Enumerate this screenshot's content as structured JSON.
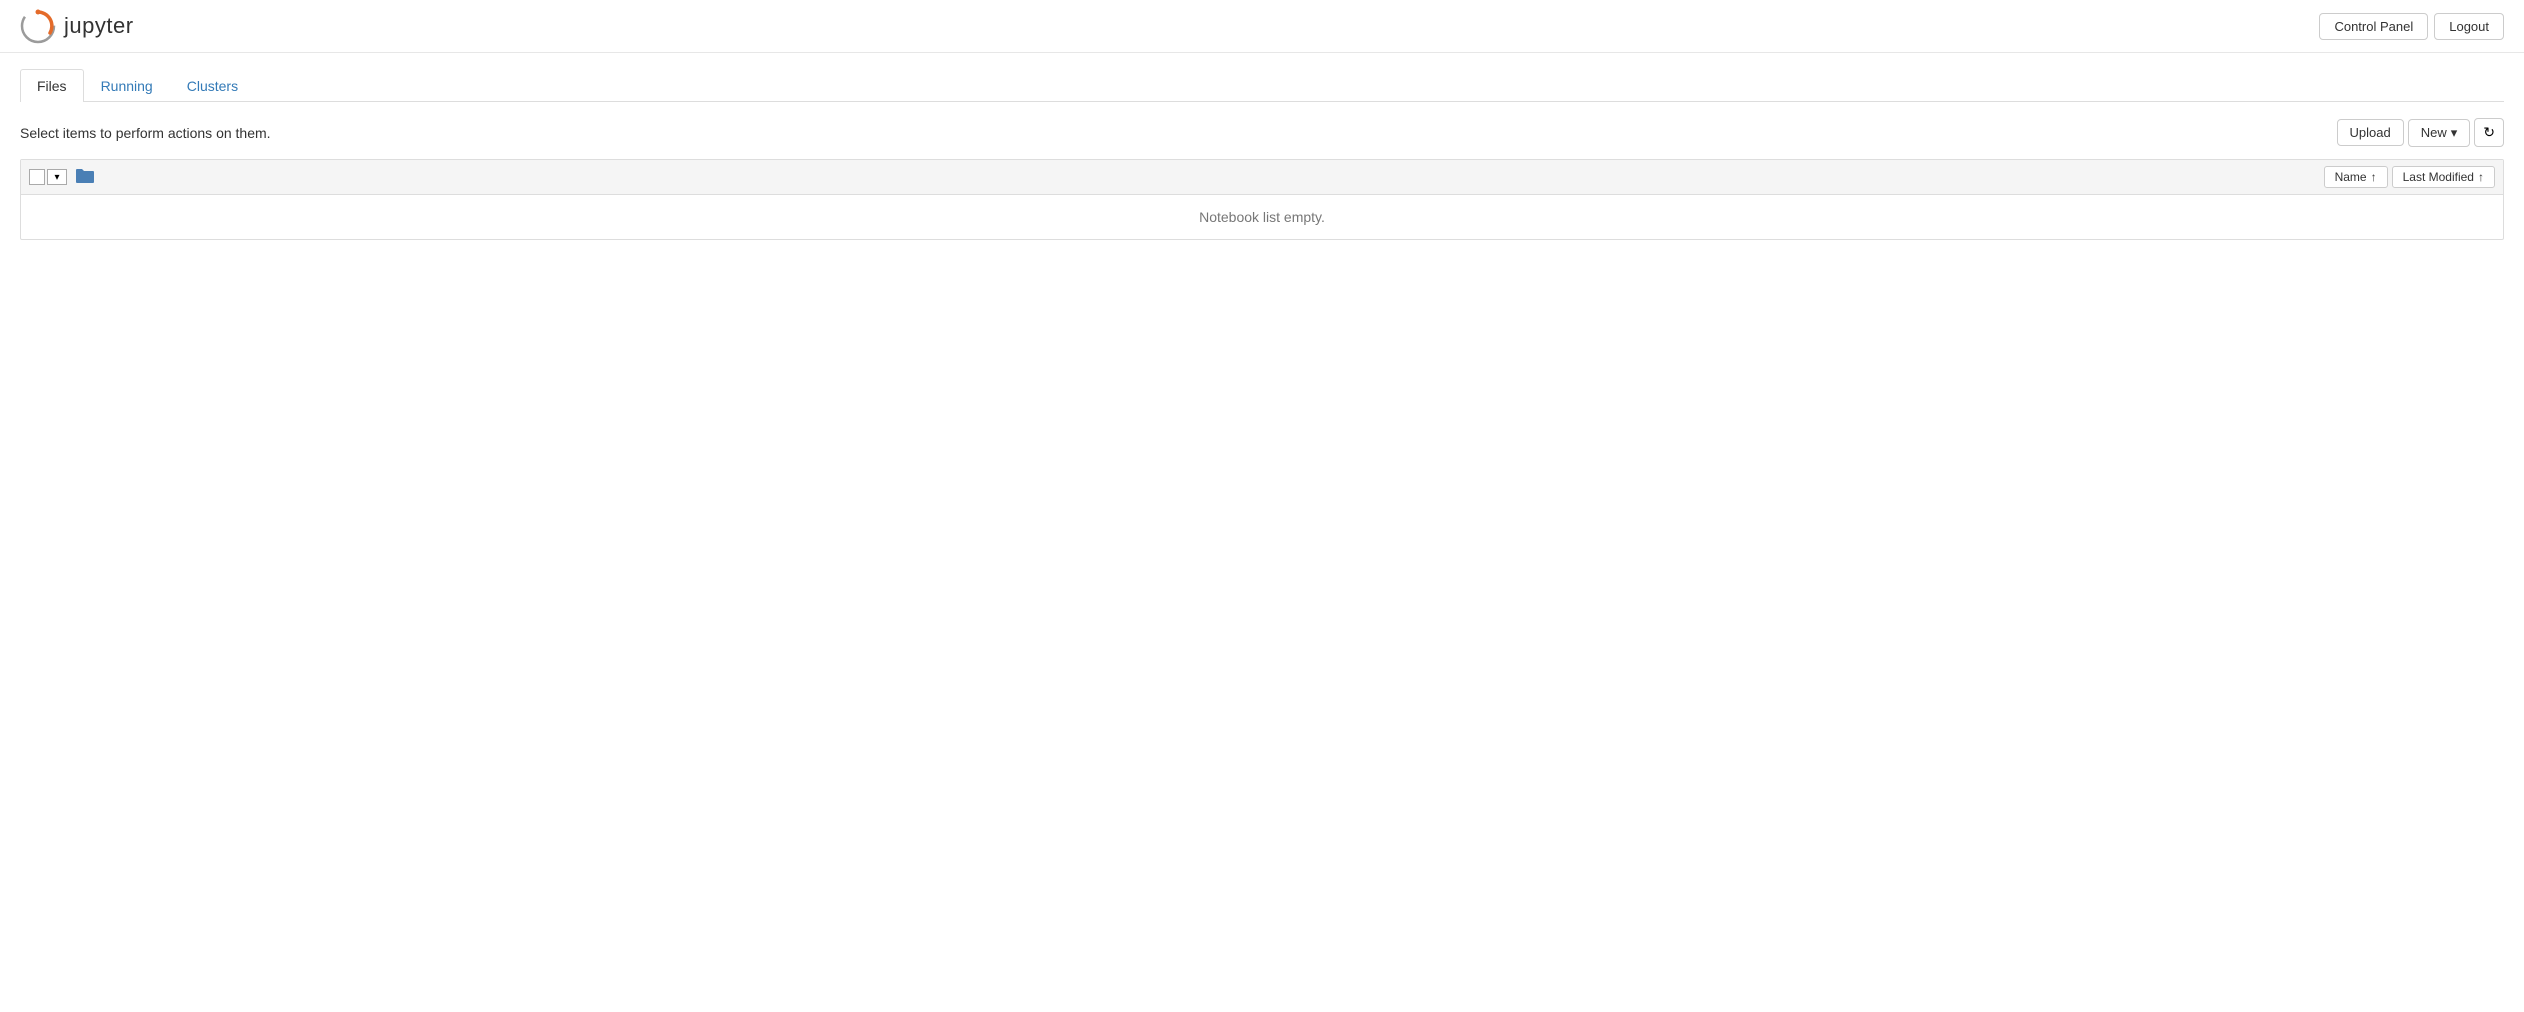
{
  "header": {
    "logo_alt": "Jupyter Logo",
    "title": "jupyter",
    "control_panel_label": "Control Panel",
    "logout_label": "Logout"
  },
  "tabs": [
    {
      "id": "files",
      "label": "Files",
      "active": true
    },
    {
      "id": "running",
      "label": "Running",
      "active": false
    },
    {
      "id": "clusters",
      "label": "Clusters",
      "active": false
    }
  ],
  "toolbar": {
    "hint_text": "Select items to perform actions on them.",
    "upload_label": "Upload",
    "new_label": "New",
    "refresh_icon": "↻"
  },
  "file_list": {
    "name_sort_label": "Name",
    "name_sort_arrow": "↑",
    "last_modified_sort_label": "Last Modified",
    "last_modified_sort_arrow": "↑",
    "empty_message": "Notebook list empty."
  }
}
